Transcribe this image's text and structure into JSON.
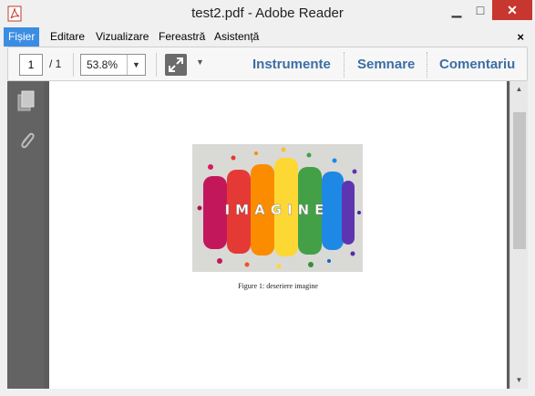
{
  "window": {
    "title": "test2.pdf - Adobe Reader",
    "minimize_glyph": "▁",
    "maximize_glyph": "□",
    "close_glyph": "✕"
  },
  "menu": {
    "items": [
      {
        "label": "Fișier",
        "active": true
      },
      {
        "label": "Editare",
        "active": false
      },
      {
        "label": "Vizualizare",
        "active": false
      },
      {
        "label": "Fereastră",
        "active": false
      },
      {
        "label": "Asistență",
        "active": false
      }
    ],
    "close_glyph": "×"
  },
  "toolbar": {
    "page_current": "1",
    "page_total": "/ 1",
    "zoom": "53.8%",
    "zoom_arrow_glyph": "▼",
    "more_glyph": "▼",
    "tools_label": "Instrumente",
    "sign_label": "Semnare",
    "comment_label": "Comentariu"
  },
  "document": {
    "figure_word": "IMAGINE",
    "caption": "Figure 1: deseriere imagine"
  },
  "scrollbar": {
    "up_glyph": "▲",
    "down_glyph": "▼"
  },
  "colors": {
    "accent": "#3b8de4",
    "link": "#3d6ea5",
    "close": "#c7372f"
  }
}
